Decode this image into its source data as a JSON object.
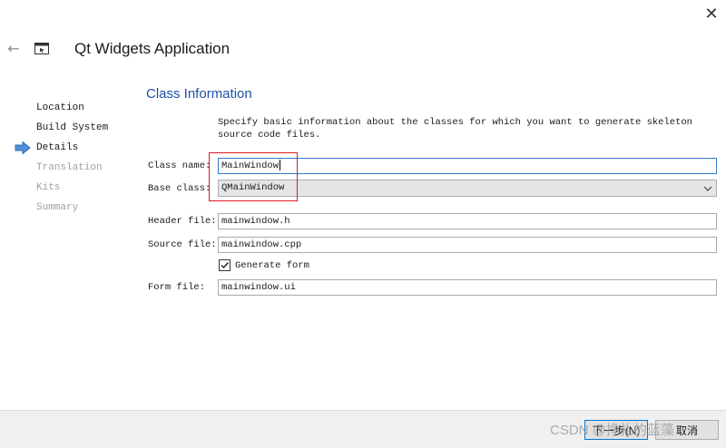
{
  "window": {
    "close_glyph": "✕"
  },
  "header": {
    "back_glyph": "←",
    "title": "Qt Widgets Application",
    "app_icon": "window-icon"
  },
  "steps": [
    {
      "label": "Location",
      "state": "done"
    },
    {
      "label": "Build System",
      "state": "done"
    },
    {
      "label": "Details",
      "state": "current"
    },
    {
      "label": "Translation",
      "state": "future"
    },
    {
      "label": "Kits",
      "state": "future"
    },
    {
      "label": "Summary",
      "state": "future"
    }
  ],
  "page": {
    "title": "Class Information",
    "description": "Specify basic information about the classes for which you want to generate skeleton source code files."
  },
  "form": {
    "class_name_label": "Class name:",
    "class_name_value": "MainWindow",
    "base_class_label": "Base class:",
    "base_class_value": "QMainWindow",
    "header_file_label": "Header file:",
    "header_file_value": "mainwindow.h",
    "source_file_label": "Source file:",
    "source_file_value": "mainwindow.cpp",
    "generate_form_label": "Generate form",
    "generate_form_checked": true,
    "form_file_label": "Form file:",
    "form_file_value": "mainwindow.ui"
  },
  "footer": {
    "next_label": "下一步(N)",
    "cancel_label": "取消",
    "watermark": "CSDN @挣扎的蓝藻"
  },
  "colors": {
    "accent": "#1f4fa6",
    "highlight": "#e0181e",
    "focus": "#2f7bd6"
  }
}
